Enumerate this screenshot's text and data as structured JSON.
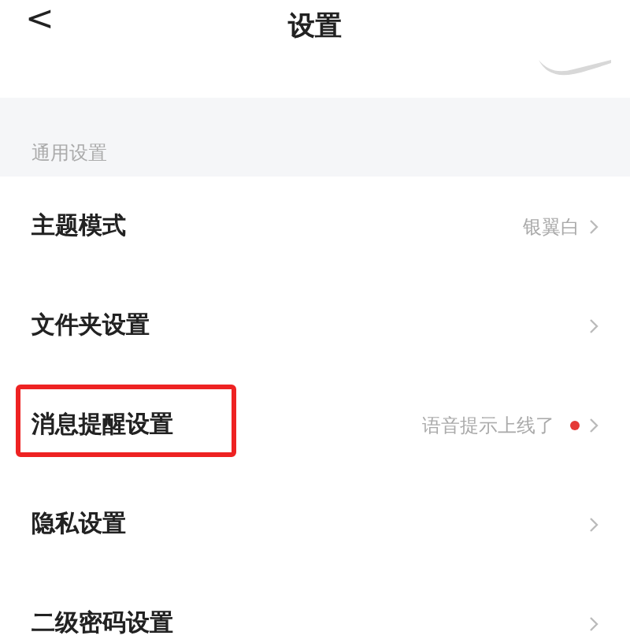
{
  "header": {
    "back": "<",
    "title": "设置"
  },
  "section": {
    "title": "通用设置"
  },
  "rows": [
    {
      "label": "主题模式",
      "value": "银翼白",
      "dot": false,
      "highlighted": false
    },
    {
      "label": "文件夹设置",
      "dot": false,
      "highlighted": false
    },
    {
      "label": "消息提醒设置",
      "value": "语音提示上线了",
      "dot": true,
      "highlighted": true
    },
    {
      "label": "隐私设置",
      "dot": false,
      "highlighted": false
    },
    {
      "label": "二级密码设置",
      "dot": false,
      "highlighted": false
    }
  ]
}
